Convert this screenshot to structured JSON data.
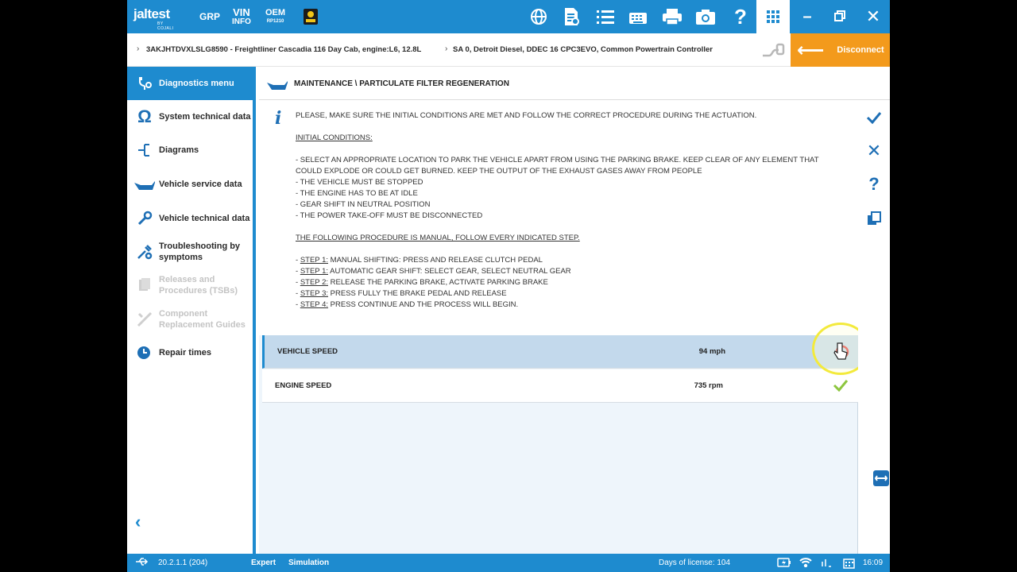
{
  "topbar": {
    "logo": "jaltest",
    "logo_sub": "BY COJALI",
    "grp": "GRP",
    "vin_line1": "VIN",
    "vin_line2": "INFO",
    "oem_line1": "OEM",
    "oem_line2": "RP1210",
    "icons": [
      "user-badge-icon",
      "globe-icon",
      "report-icon",
      "list-icon",
      "keyboard-icon",
      "printer-icon",
      "camera-icon",
      "help-icon",
      "apps-grid-icon",
      "minimize-icon",
      "restore-icon",
      "close-icon"
    ]
  },
  "breadcrumb": {
    "vehicle": "3AKJHTDVXLSLG8590 - Freightliner Cascadia 116 Day Cab, engine:L6, 12.8L",
    "system": "SA 0, Detroit Diesel, DDEC 16 CPC3EVO, Common Powertrain Controller",
    "disconnect_label": "Disconnect"
  },
  "sidebar": {
    "items": [
      {
        "label": "Diagnostics menu",
        "icon": "diagnostics-icon",
        "state": "active"
      },
      {
        "label": "System technical data",
        "icon": "ohm-icon",
        "state": "normal"
      },
      {
        "label": "Diagrams",
        "icon": "diagram-icon",
        "state": "normal"
      },
      {
        "label": "Vehicle service data",
        "icon": "oil-can-icon",
        "state": "normal"
      },
      {
        "label": "Vehicle technical data",
        "icon": "wrench-icon",
        "state": "normal"
      },
      {
        "label": "Troubleshooting by symptoms",
        "icon": "troubleshoot-icon",
        "state": "normal"
      },
      {
        "label": "Releases and Procedures (TSBs)",
        "icon": "documents-icon",
        "state": "disabled"
      },
      {
        "label": "Component Replacement Guides",
        "icon": "tools-icon",
        "state": "disabled"
      },
      {
        "label": "Repair times",
        "icon": "clock-icon",
        "state": "normal"
      }
    ]
  },
  "header": {
    "title": "MAINTENANCE \\ PARTICULATE FILTER REGENERATION"
  },
  "info": {
    "intro": "PLEASE, MAKE SURE THE INITIAL CONDITIONS ARE MET AND FOLLOW THE CORRECT PROCEDURE DURING THE ACTUATION.",
    "conditions_title": "INITIAL CONDITIONS:",
    "conditions": [
      "- SELECT AN APPROPRIATE LOCATION TO PARK THE VEHICLE APART FROM USING THE PARKING BRAKE. KEEP CLEAR OF ANY ELEMENT THAT",
      "COULD EXPLODE OR COULD GET BURNED. KEEP THE OUTPUT OF THE EXHAUST GASES AWAY FROM PEOPLE",
      "- THE VEHICLE MUST BE STOPPED",
      "- THE ENGINE HAS TO BE AT IDLE",
      "- GEAR SHIFT IN NEUTRAL POSITION",
      "- THE POWER TAKE-OFF MUST BE DISCONNECTED"
    ],
    "procedure_title": "THE FOLLOWING PROCEDURE IS MANUAL, FOLLOW EVERY INDICATED STEP.",
    "steps": [
      {
        "step": "STEP 1:",
        "text": " MANUAL SHIFTING: PRESS AND RELEASE CLUTCH PEDAL"
      },
      {
        "step": "STEP 1:",
        "text": " AUTOMATIC GEAR SHIFT: SELECT GEAR, SELECT NEUTRAL GEAR"
      },
      {
        "step": "STEP 2:",
        "text": " RELEASE THE PARKING BRAKE, ACTIVATE PARKING BRAKE"
      },
      {
        "step": "STEP 3:",
        "text": " PRESS FULLY THE BRAKE PEDAL AND RELEASE"
      },
      {
        "step": "STEP 4:",
        "text": " PRESS CONTINUE AND THE PROCESS WILL BEGIN."
      }
    ]
  },
  "parameters": [
    {
      "name": "VEHICLE SPEED",
      "value": "94 mph",
      "status": "error",
      "selected": true
    },
    {
      "name": "ENGINE SPEED",
      "value": "735 rpm",
      "status": "ok",
      "selected": false
    }
  ],
  "rail": [
    "confirm-icon",
    "cancel-icon",
    "help-icon",
    "copy-icon"
  ],
  "status": {
    "version": "20.2.1.1 (204)",
    "mode": "Expert",
    "simulation": "Simulation",
    "license": "Days of license: 104",
    "time": "16:09"
  },
  "colors": {
    "primary": "#1e8bcf",
    "accent": "#f39a1c",
    "selected_row": "#c3d9ec",
    "ok": "#8dc63f",
    "error": "#e03a3a"
  }
}
